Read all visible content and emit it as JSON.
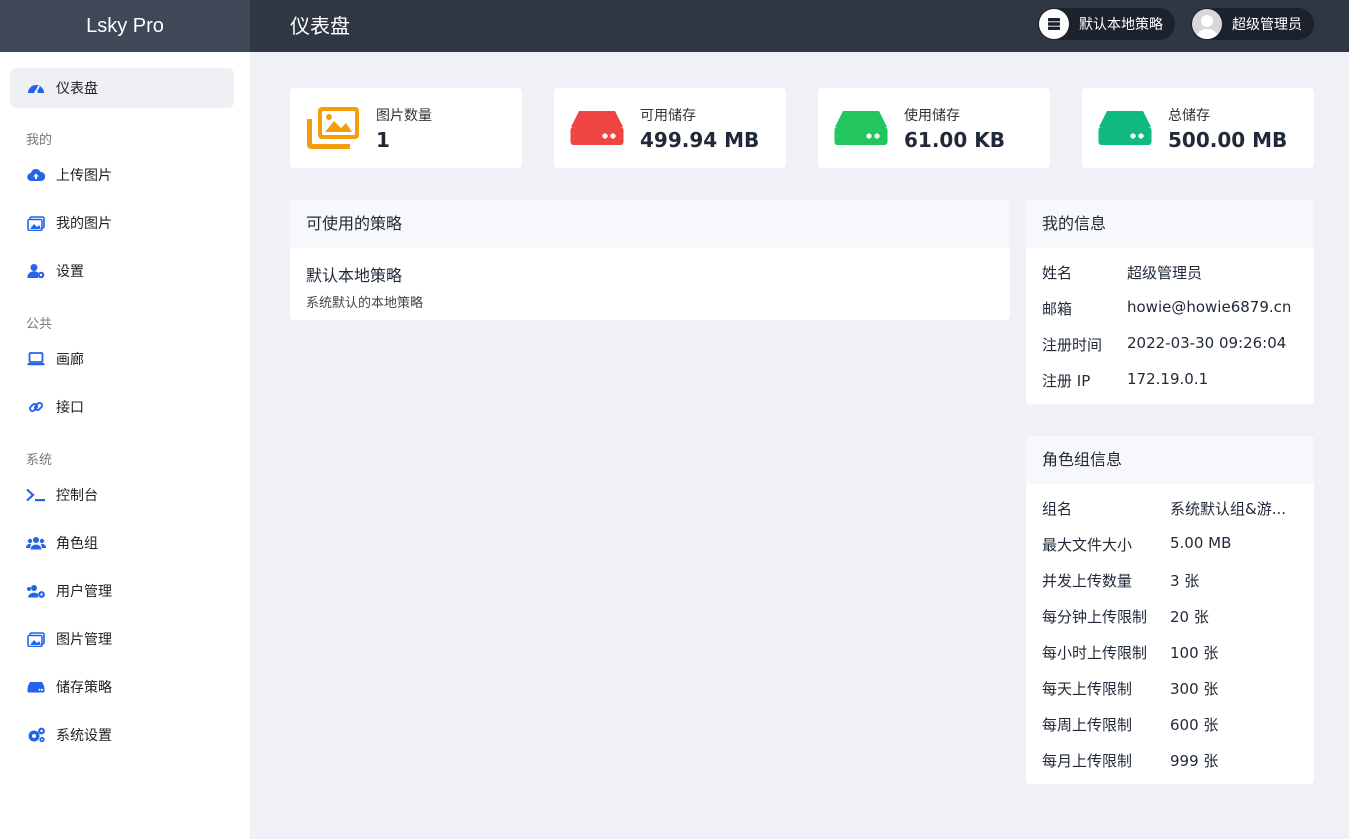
{
  "app": {
    "brand": "Lsky Pro",
    "page_title": "仪表盘"
  },
  "header": {
    "strategy_label": "默认本地策略",
    "user_label": "超级管理员"
  },
  "sidebar": {
    "dashboard": "仪表盘",
    "section_mine": "我的",
    "upload": "上传图片",
    "my_images": "我的图片",
    "settings": "设置",
    "section_public": "公共",
    "gallery": "画廊",
    "api": "接口",
    "section_system": "系统",
    "console": "控制台",
    "roles": "角色组",
    "users": "用户管理",
    "images": "图片管理",
    "storage": "储存策略",
    "system_settings": "系统设置"
  },
  "stats": [
    {
      "label": "图片数量",
      "value": "1",
      "color": "#f59e0b"
    },
    {
      "label": "可用储存",
      "value": "499.94 MB",
      "color": "#ef4444"
    },
    {
      "label": "使用储存",
      "value": "61.00 KB",
      "color": "#22c55e"
    },
    {
      "label": "总储存",
      "value": "500.00 MB",
      "color": "#10b981"
    }
  ],
  "policies": {
    "title": "可使用的策略",
    "name": "默认本地策略",
    "desc": "系统默认的本地策略"
  },
  "my_info": {
    "title": "我的信息",
    "rows": [
      {
        "k": "姓名",
        "v": "超级管理员"
      },
      {
        "k": "邮箱",
        "v": "howie@howie6879.cn"
      },
      {
        "k": "注册时间",
        "v": "2022-03-30 09:26:04"
      },
      {
        "k": "注册 IP",
        "v": "172.19.0.1"
      }
    ]
  },
  "role_info": {
    "title": "角色组信息",
    "rows": [
      {
        "k": "组名",
        "v": "系统默认组&游..."
      },
      {
        "k": "最大文件大小",
        "v": "5.00 MB"
      },
      {
        "k": "并发上传数量",
        "v": "3 张"
      },
      {
        "k": "每分钟上传限制",
        "v": "20 张"
      },
      {
        "k": "每小时上传限制",
        "v": "100 张"
      },
      {
        "k": "每天上传限制",
        "v": "300 张"
      },
      {
        "k": "每周上传限制",
        "v": "600 张"
      },
      {
        "k": "每月上传限制",
        "v": "999 张"
      }
    ]
  },
  "colors": {
    "accent": "#2563eb",
    "topbar": "#2f3744"
  }
}
